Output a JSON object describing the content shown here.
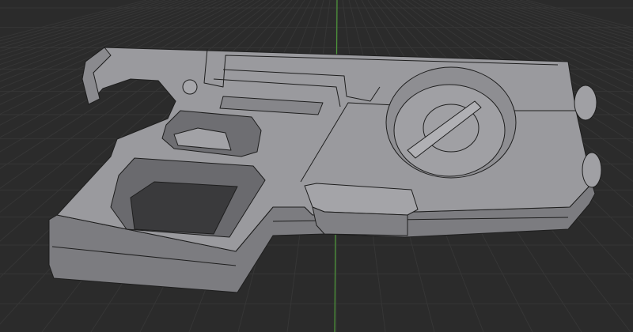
{
  "viewport": {
    "background_color": "#2b2b2b",
    "grid_color": "#363636",
    "axis_y_color": "#4e9a3a",
    "model_top_color": "#9a9a9e",
    "model_side_color": "#7c7c80",
    "model_edge_color": "#1e1e1e",
    "model_recess_color": "#86868a"
  }
}
